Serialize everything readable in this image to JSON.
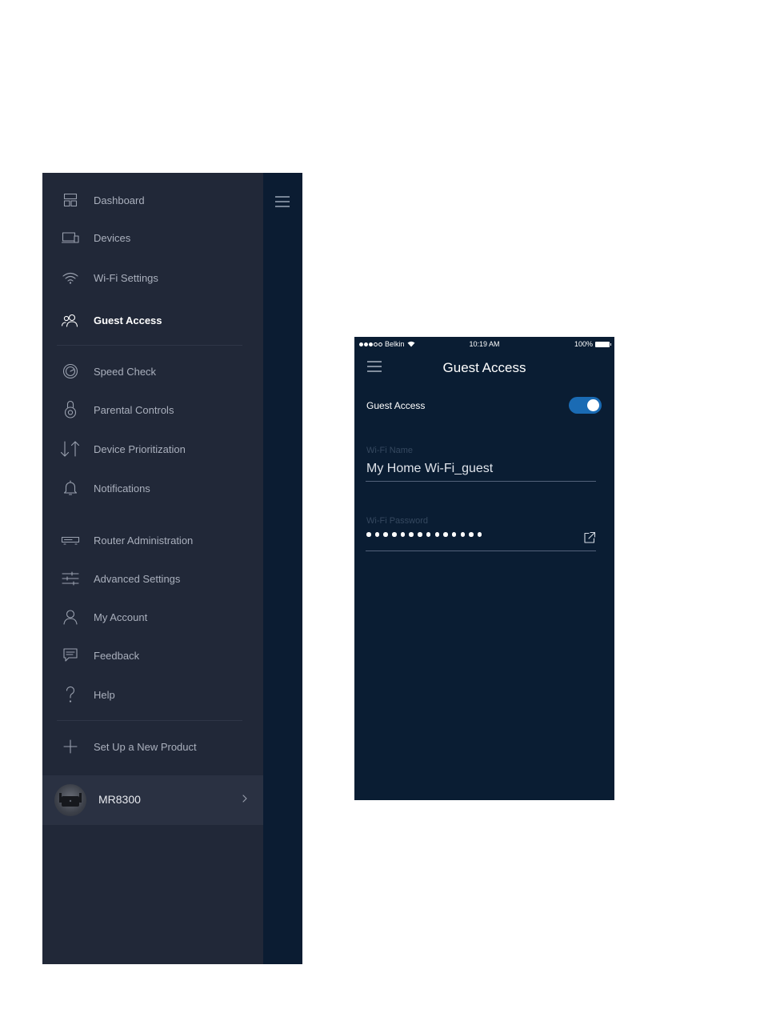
{
  "menu": {
    "items": [
      {
        "label": "Dashboard",
        "icon": "dashboard-icon"
      },
      {
        "label": "Devices",
        "icon": "devices-icon"
      },
      {
        "label": "Wi-Fi Settings",
        "icon": "wifi-icon"
      },
      {
        "label": "Guest Access",
        "icon": "guest-access-icon",
        "active": true
      },
      {
        "label": "Speed Check",
        "icon": "speedometer-icon"
      },
      {
        "label": "Parental Controls",
        "icon": "parental-controls-icon"
      },
      {
        "label": "Device Prioritization",
        "icon": "prioritization-arrows-icon"
      },
      {
        "label": "Notifications",
        "icon": "bell-icon"
      },
      {
        "label": "Router Administration",
        "icon": "router-icon"
      },
      {
        "label": "Advanced Settings",
        "icon": "sliders-icon"
      },
      {
        "label": "My Account",
        "icon": "user-icon"
      },
      {
        "label": "Feedback",
        "icon": "chat-bubble-icon"
      },
      {
        "label": "Help",
        "icon": "question-mark-icon"
      },
      {
        "label": "Set Up a New Product",
        "icon": "plus-icon"
      }
    ],
    "device": {
      "name": "MR8300"
    }
  },
  "guest_screen": {
    "status_bar": {
      "carrier": "Belkin",
      "time": "10:19 AM",
      "battery": "100%"
    },
    "title": "Guest Access",
    "toggle": {
      "label": "Guest Access",
      "on": true
    },
    "wifi_name": {
      "caption": "Wi-Fi Name",
      "value": "My Home Wi-Fi_guest"
    },
    "wifi_password": {
      "caption": "Wi-Fi Password",
      "masked_length": 14
    }
  },
  "colors": {
    "menu_bg": "#212838",
    "rail_bg": "#0b1c32",
    "screen_bg": "#0a1d33",
    "toggle_on": "#1a6bb4"
  }
}
